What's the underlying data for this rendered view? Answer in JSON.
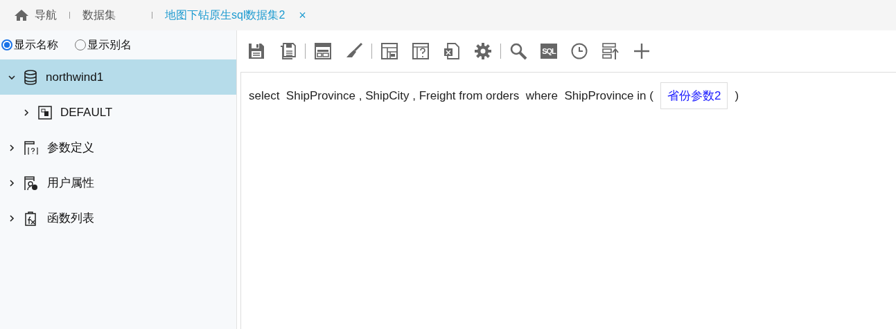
{
  "tabs": [
    {
      "kind": "home",
      "label": "导航",
      "selected": false
    },
    {
      "kind": "plain",
      "label": "数据集",
      "selected": false
    },
    {
      "kind": "closable",
      "label": "地图下钻原生sql数据集2",
      "selected": true,
      "close": "×"
    }
  ],
  "display_mode": [
    {
      "label": "显示名称",
      "selected": true
    },
    {
      "label": "显示别名",
      "selected": false
    }
  ],
  "tree": [
    {
      "label": "northwind1",
      "kind": "database",
      "expanded": true,
      "selected": true,
      "children": [
        {
          "label": "DEFAULT",
          "kind": "schema",
          "expanded": false,
          "selected": false
        }
      ]
    },
    {
      "label": "参数定义",
      "kind": "params",
      "expanded": false,
      "selected": false
    },
    {
      "label": "用户属性",
      "kind": "user",
      "expanded": false,
      "selected": false
    },
    {
      "label": "函数列表",
      "kind": "function",
      "expanded": false,
      "selected": false
    }
  ],
  "toolbar": [
    {
      "kind": "save"
    },
    {
      "kind": "save-as"
    },
    {
      "kind": "separator"
    },
    {
      "kind": "layout"
    },
    {
      "kind": "brush"
    },
    {
      "kind": "separator"
    },
    {
      "kind": "table"
    },
    {
      "kind": "param"
    },
    {
      "kind": "excel"
    },
    {
      "kind": "gear"
    },
    {
      "kind": "separator"
    },
    {
      "kind": "search"
    },
    {
      "kind": "sql",
      "text": "SQL"
    },
    {
      "kind": "clock"
    },
    {
      "kind": "stack"
    },
    {
      "kind": "plus"
    }
  ],
  "sql": [
    {
      "kind": "text",
      "text": "select  ShipProvince , ShipCity , Freight from orders  where  ShipProvince in ("
    },
    {
      "kind": "param",
      "text": "省份参数2"
    },
    {
      "kind": "text",
      "text": ")"
    }
  ]
}
